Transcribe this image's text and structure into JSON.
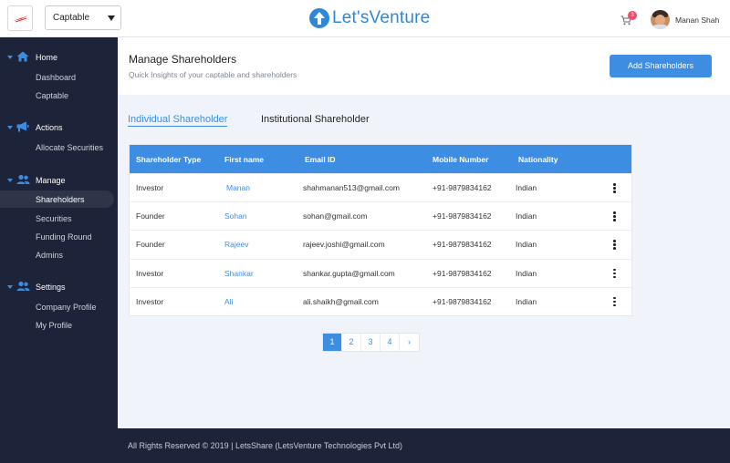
{
  "header": {
    "company_select": "Captable",
    "brand": "Let'sVenture",
    "cart_count": "3",
    "user_name": "Manan Shah"
  },
  "sidebar": {
    "sections": [
      {
        "label": "Home",
        "icon": "home-icon",
        "items": [
          "Dashboard",
          "Captable"
        ]
      },
      {
        "label": "Actions",
        "icon": "megaphone-icon",
        "items": [
          "Allocate Securities"
        ]
      },
      {
        "label": "Manage",
        "icon": "users-icon",
        "items": [
          "Shareholders",
          "Securities",
          "Funding Round",
          "Admins"
        ]
      },
      {
        "label": "Settings",
        "icon": "users-icon",
        "items": [
          "Company Profile",
          "My Profile"
        ]
      }
    ],
    "active_item": "Shareholders"
  },
  "page": {
    "title": "Manage Shareholders",
    "subtitle": "Quick Insights of your captable and shareholders",
    "add_button": "Add Shareholders"
  },
  "tabs": [
    "Individual Shareholder",
    "Institutional Shareholder"
  ],
  "table": {
    "columns": [
      "Shareholder Type",
      "First name",
      "Email ID",
      "Mobile Number",
      "Nationality"
    ],
    "rows": [
      [
        "Investor",
        "Manan",
        "shahmanan513@gmail.com",
        "+91-9879834162",
        "Indian"
      ],
      [
        "Founder",
        "Sohan",
        "sohan@gmail.com",
        "+91-9879834162",
        "Indian"
      ],
      [
        "Founder",
        "Rajeev",
        "rajeev.joshi@gmail.com",
        "+91-9879834162",
        "Indian"
      ],
      [
        "Investor",
        "Shankar",
        "shankar.gupta@gmail.com",
        "+91-9879834162",
        "Indian"
      ],
      [
        "Investor",
        "Ali",
        "ali.shaikh@gmail.com",
        "+91-9879834162",
        "Indian"
      ]
    ]
  },
  "pagination": [
    "1",
    "2",
    "3",
    "4",
    "›"
  ],
  "footer": "All Rights Reserved © 2019 | LetsShare (LetsVenture Technologies Pvt Ltd)",
  "colors": {
    "accent": "#3d8ee2",
    "sidebar": "#1d2338",
    "background": "#f0f3f9"
  }
}
